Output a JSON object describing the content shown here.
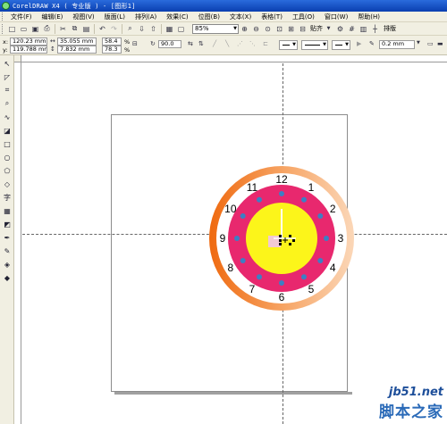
{
  "app": {
    "title": "CorelDRAW X4 ( 专业版 ) - [图形1]"
  },
  "menu": {
    "items": [
      "文件(F)",
      "编辑(E)",
      "视图(V)",
      "版面(L)",
      "排列(A)",
      "效果(C)",
      "位图(B)",
      "文本(X)",
      "表格(T)",
      "工具(O)",
      "窗口(W)",
      "帮助(H)"
    ]
  },
  "toolbar": {
    "zoom_value": "85%",
    "snap_label": "贴齐",
    "layout_label": "排版"
  },
  "properties": {
    "x_label": "x:",
    "x_value": "120.23 mm",
    "y_label": "y:",
    "y_value": "119.788 mm",
    "width_value": "35.055 mm",
    "height_value": "7.832 mm",
    "scale_x": "58.4",
    "scale_y": "78.3",
    "percent_symbol": "%",
    "rotation": "90.0",
    "outline_width": "0.2 mm"
  },
  "clock": {
    "numbers": [
      "12",
      "1",
      "2",
      "3",
      "4",
      "5",
      "6",
      "7",
      "8",
      "9",
      "10",
      "11"
    ],
    "colors": {
      "outer_ring": "#f07722",
      "white_ring": "#ffffff",
      "magenta_ring": "#e8286e",
      "dots": "#3c7fc4",
      "center": "#fcf51a"
    }
  },
  "watermark": {
    "site": "jb51.net",
    "brand": "脚本之家"
  },
  "icons": {
    "toolbox": [
      "pick-tool-icon",
      "shape-tool-icon",
      "crop-tool-icon",
      "zoom-tool-icon",
      "freehand-tool-icon",
      "smart-fill-icon",
      "rectangle-tool-icon",
      "ellipse-tool-icon",
      "polygon-tool-icon",
      "basic-shapes-icon",
      "text-tool-icon",
      "table-tool-icon",
      "interactive-blend-icon",
      "eyedropper-icon",
      "outline-pen-icon",
      "fill-tool-icon",
      "interactive-fill-icon"
    ]
  }
}
